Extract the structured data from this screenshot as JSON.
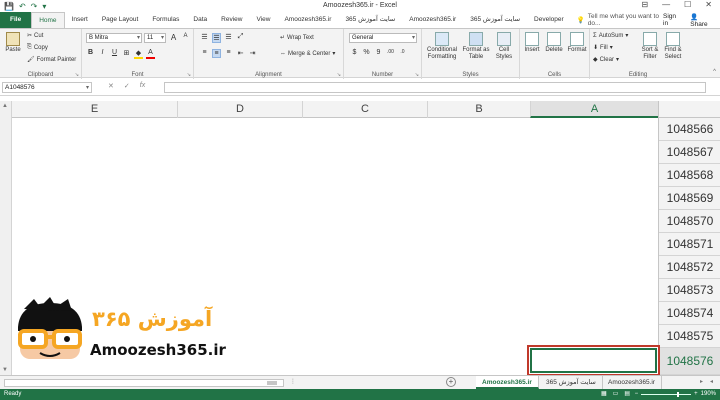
{
  "window": {
    "title": "Amoozesh365.ir - Excel",
    "min": "—",
    "max": "☐",
    "close": "✕",
    "ribbon_display": "⊟"
  },
  "qat": {
    "save": "💾",
    "undo": "↶",
    "redo": "↷",
    "more": "▾"
  },
  "tabs": {
    "file": "File",
    "home": "Home",
    "insert": "Insert",
    "page_layout": "Page Layout",
    "formulas": "Formulas",
    "data": "Data",
    "review": "Review",
    "view": "View",
    "addin1": "Amoozesh365.ir",
    "addin2": "سایت آموزش 365",
    "addin3": "Amoozesh365.ir",
    "addin4": "سایت آموزش 365",
    "developer": "Developer",
    "tell_me": "Tell me what you want to do...",
    "sign_in": "Sign in",
    "share": "Share"
  },
  "ribbon": {
    "clipboard": {
      "paste": "Paste",
      "cut": "Cut",
      "copy": "Copy",
      "format_painter": "Format Painter",
      "label": "Clipboard"
    },
    "font": {
      "font_name": "B Mitra",
      "font_size": "11",
      "bold": "B",
      "italic": "I",
      "underline": "U",
      "grow": "A",
      "shrink": "A",
      "label": "Font"
    },
    "alignment": {
      "wrap_text": "Wrap Text",
      "merge_center": "Merge & Center",
      "label": "Alignment"
    },
    "number": {
      "format": "General",
      "currency": "$",
      "percent": "%",
      "comma": "9",
      "inc_dec": ".00",
      "dec_dec": ".0",
      "label": "Number"
    },
    "styles": {
      "conditional": "Conditional Formatting",
      "format_table": "Format as Table",
      "cell_styles": "Cell Styles",
      "label": "Styles"
    },
    "cells": {
      "insert": "Insert",
      "delete": "Delete",
      "format": "Format",
      "label": "Cells"
    },
    "editing": {
      "autosum": "AutoSum",
      "fill": "Fill",
      "clear": "Clear",
      "sort_filter": "Sort & Filter",
      "find_select": "Find & Select",
      "label": "Editing"
    }
  },
  "formula_bar": {
    "name_box": "A1048576",
    "cancel": "✕",
    "enter": "✓",
    "fx": "fx",
    "value": ""
  },
  "columns": [
    "E",
    "D",
    "C",
    "B",
    "A"
  ],
  "active_column": "A",
  "rows": [
    "1048566",
    "1048567",
    "1048568",
    "1048569",
    "1048570",
    "1048571",
    "1048572",
    "1048573",
    "1048574",
    "1048575",
    "1048576"
  ],
  "active_row": "1048576",
  "logo": {
    "text": "Amoozesh365.ir",
    "persian": "آموزش ۳۶۵"
  },
  "sheets": [
    {
      "name": "Amoozesh365.ir",
      "active": true
    },
    {
      "name": "سایت آموزش 365",
      "active": false
    },
    {
      "name": "Amoozesh365.ir",
      "active": false
    }
  ],
  "status": {
    "ready": "Ready",
    "zoom": "190%",
    "minus": "−",
    "plus": "+"
  },
  "colors": {
    "excel_green": "#217346",
    "highlight_red": "#c0392b",
    "logo_orange": "#f5a623"
  }
}
